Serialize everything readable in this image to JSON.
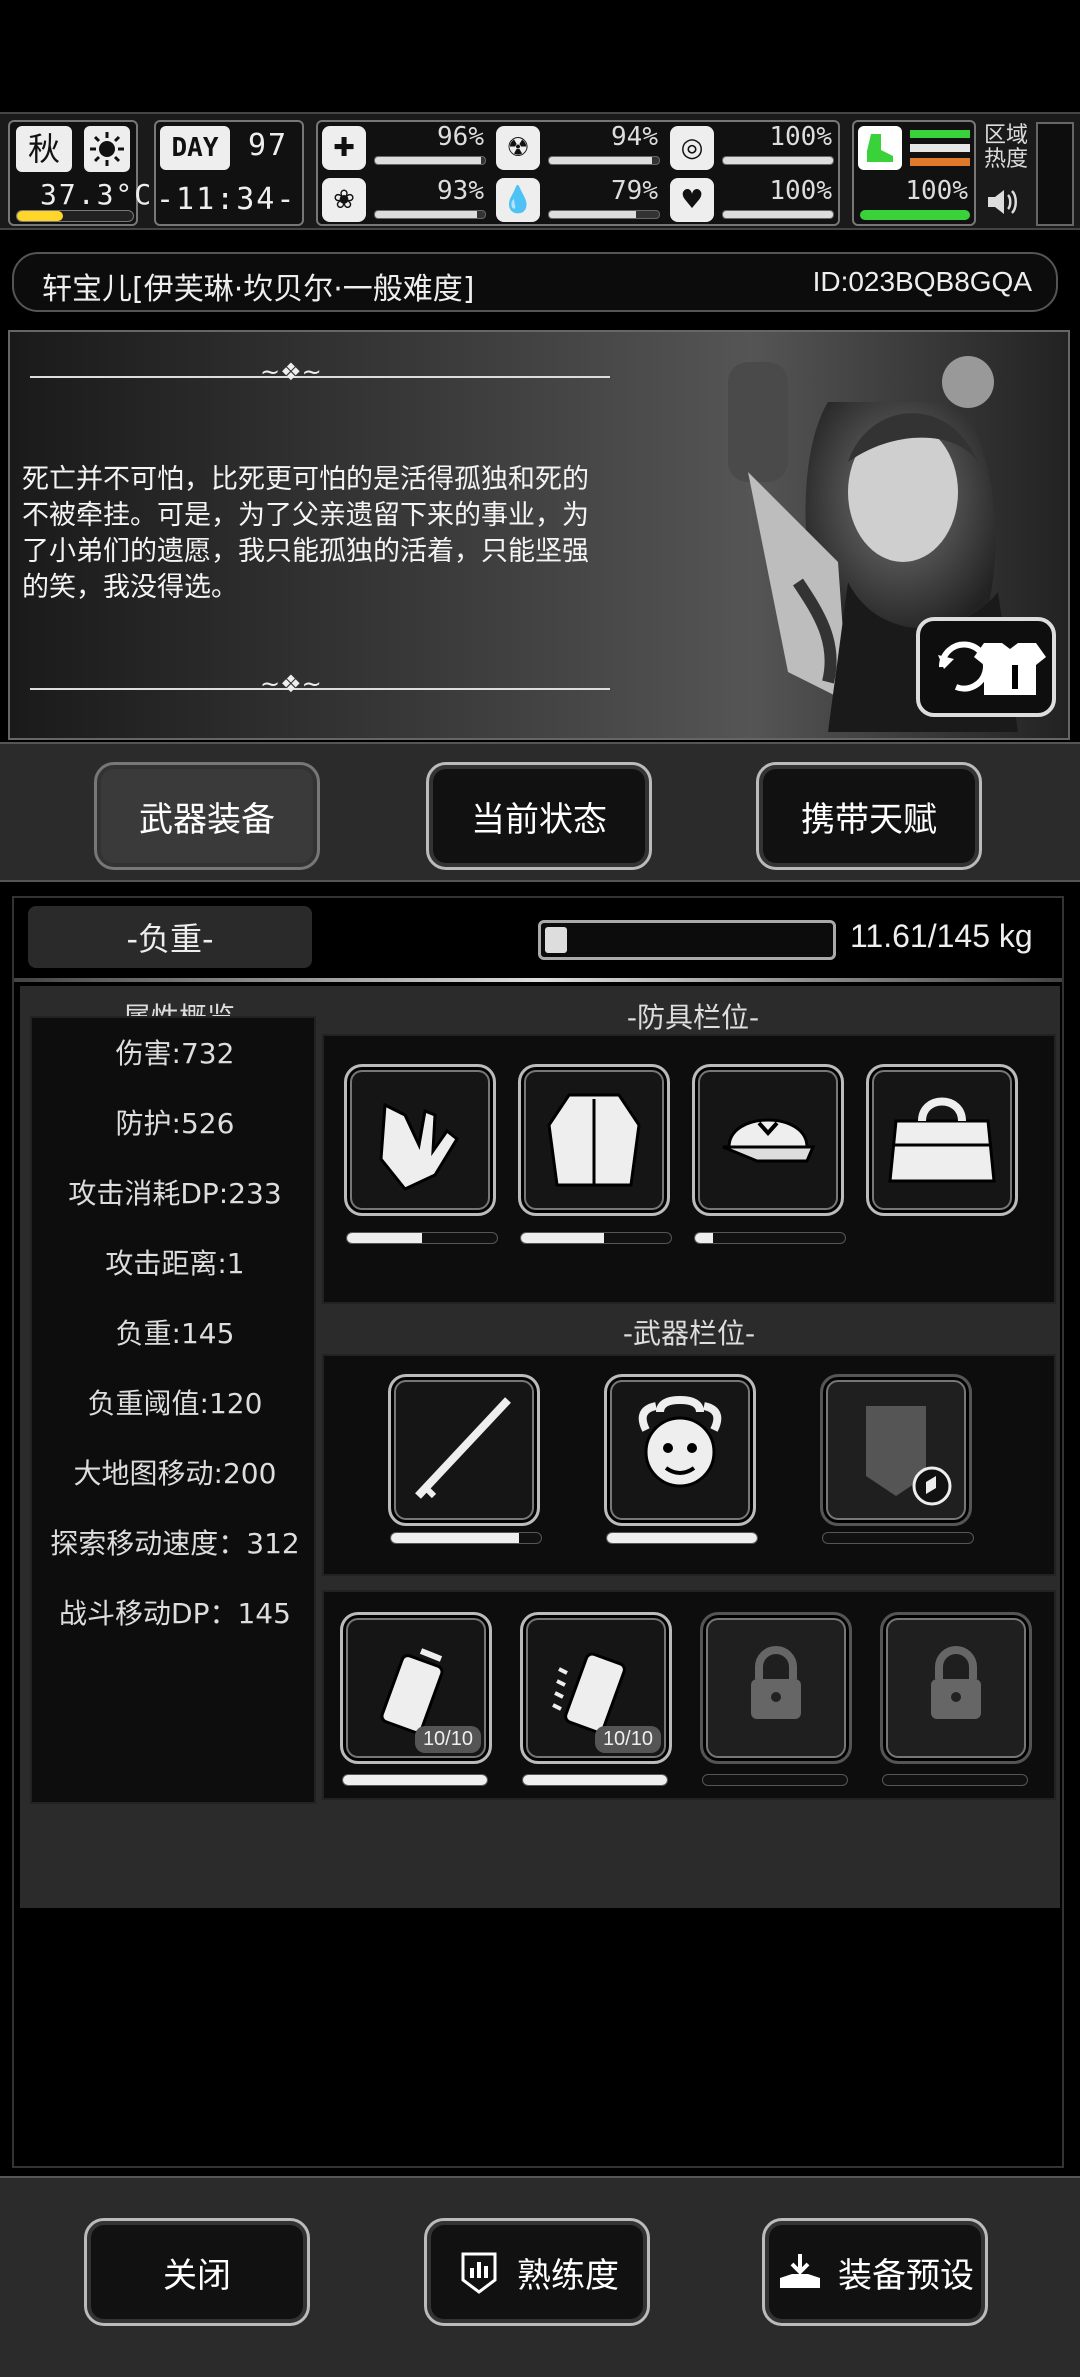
{
  "status": {
    "season": "秋",
    "temperature": "37.3°C",
    "day_label": "DAY",
    "day": "97",
    "time": "-11:34-",
    "region_heat": "区域\n热度",
    "stats": [
      {
        "icon": "medkit-icon",
        "value": "96%",
        "fill": 0.96
      },
      {
        "icon": "stomach-icon",
        "value": "94%",
        "fill": 0.94
      },
      {
        "icon": "pill-icon",
        "value": "100%",
        "fill": 1.0
      },
      {
        "icon": "brain-icon",
        "value": "93%",
        "fill": 0.93
      },
      {
        "icon": "water-drop-icon",
        "value": "79%",
        "fill": 0.79
      },
      {
        "icon": "heart-icon",
        "value": "100%",
        "fill": 1.0
      }
    ],
    "stamina": "100%"
  },
  "character": {
    "name": "轩宝儿[伊芙琳·坎贝尔·一般难度]",
    "id": "ID:023BQB8GQA",
    "story": "死亡并不可怕，比死更可怕的是活得孤独和死的不被牵挂。可是，为了父亲遗留下来的事业，为了小弟们的遗愿，我只能孤独的活着，只能坚强的笑，我没得选。"
  },
  "tabs": [
    "武器装备",
    "当前状态",
    "携带天赋"
  ],
  "weight": {
    "label": "-负重-",
    "value": "11.61/145 kg",
    "fill": 0.08
  },
  "attributes": {
    "title": "-属性概览-",
    "items": [
      "伤害:732",
      "防护:526",
      "攻击消耗DP:233",
      "攻击距离:1",
      "负重:145",
      "负重阈值:120",
      "大地图移动:200",
      "探索移动速度：312",
      "战斗移动DP：145"
    ]
  },
  "armor": {
    "title": "-防具栏位-",
    "slots": [
      {
        "icon": "gloves-icon",
        "durability": 0.5
      },
      {
        "icon": "coat-icon",
        "durability": 0.55
      },
      {
        "icon": "cap-icon",
        "durability": 0.1
      },
      {
        "icon": "bag-icon",
        "durability": 0
      }
    ]
  },
  "weapons": {
    "title": "-武器栏位-",
    "slots": [
      {
        "icon": "spear-icon",
        "durability": 0.85
      },
      {
        "icon": "medusa-icon",
        "durability": 1.0
      },
      {
        "icon": "shield-icon",
        "durability": 0
      }
    ]
  },
  "throwables": {
    "slots": [
      {
        "icon": "grenade-icon",
        "count": "10/10",
        "durability": 1.0,
        "locked": false
      },
      {
        "icon": "spiked-grenade-icon",
        "count": "10/10",
        "durability": 1.0,
        "locked": false
      },
      {
        "icon": "lock-icon",
        "count": "",
        "durability": 0,
        "locked": true
      },
      {
        "icon": "lock-icon",
        "count": "",
        "durability": 0,
        "locked": true
      }
    ]
  },
  "bottom": {
    "close": "关闭",
    "proficiency": "熟练度",
    "preset": "装备预设"
  }
}
